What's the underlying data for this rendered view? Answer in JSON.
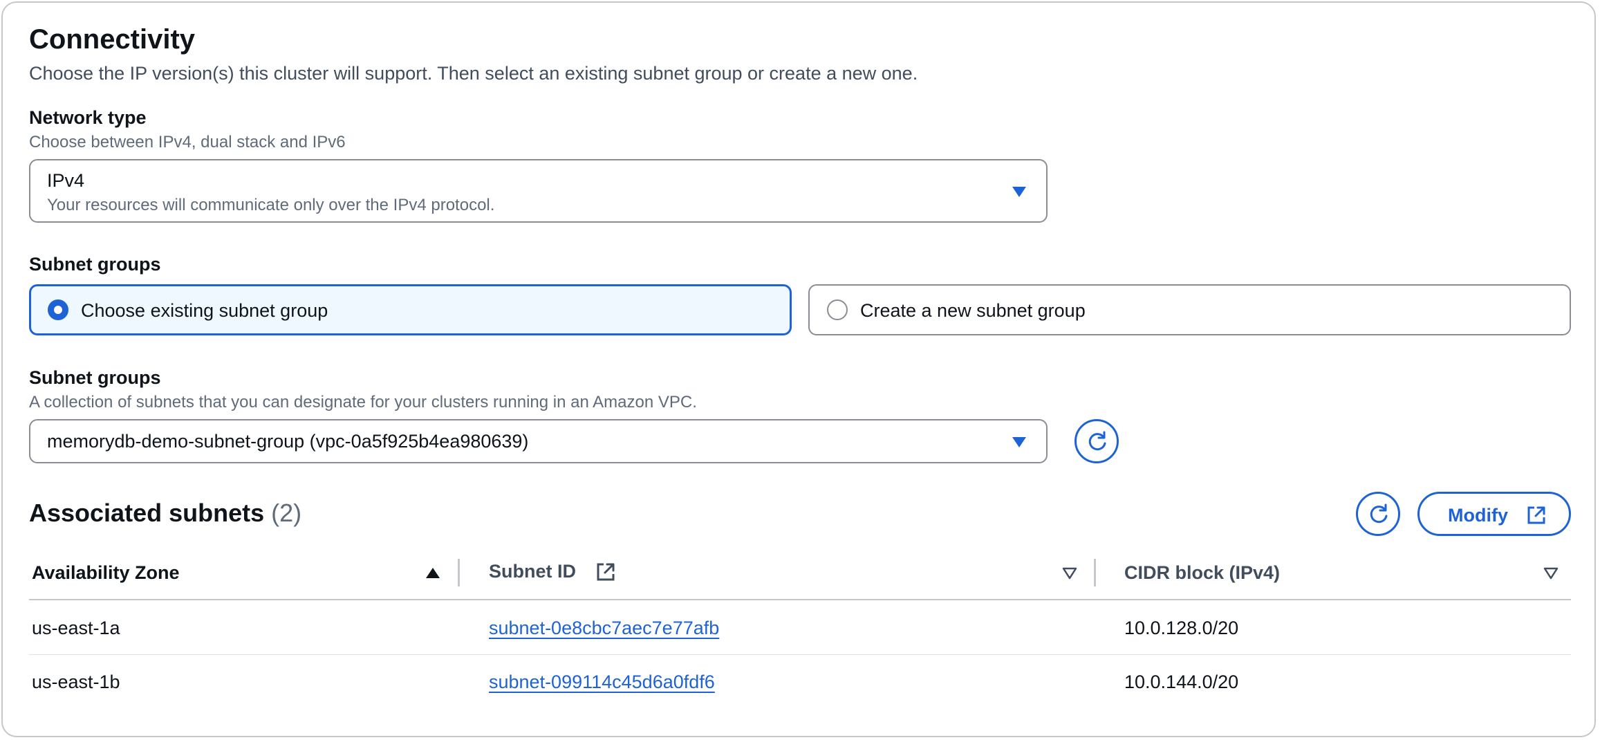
{
  "connectivity": {
    "title": "Connectivity",
    "description": "Choose the IP version(s) this cluster will support. Then select an existing subnet group or create a new one."
  },
  "network_type": {
    "label": "Network type",
    "description": "Choose between IPv4, dual stack and IPv6",
    "selected_value": "IPv4",
    "selected_hint": "Your resources will communicate only over the IPv4 protocol."
  },
  "subnet_group_mode": {
    "label": "Subnet groups",
    "options": [
      {
        "label": "Choose existing subnet group",
        "selected": true
      },
      {
        "label": "Create a new subnet group",
        "selected": false
      }
    ]
  },
  "subnet_groups": {
    "label": "Subnet groups",
    "description": "A collection of subnets that you can designate for your clusters running in an Amazon VPC.",
    "selected_value": "memorydb-demo-subnet-group (vpc-0a5f925b4ea980639)"
  },
  "associated_subnets": {
    "title": "Associated subnets",
    "count": "(2)",
    "modify_label": "Modify",
    "columns": [
      "Availability Zone",
      "Subnet ID",
      "CIDR block (IPv4)"
    ],
    "rows": [
      {
        "az": "us-east-1a",
        "subnet_id": "subnet-0e8cbc7aec7e77afb",
        "cidr": "10.0.128.0/20"
      },
      {
        "az": "us-east-1b",
        "subnet_id": "subnet-099114c45d6a0fdf6",
        "cidr": "10.0.144.0/20"
      }
    ]
  },
  "colors": {
    "accent": "#1e63d6",
    "selected_tile_bg": "#f0f8ff",
    "border": "#8c8c94"
  },
  "icons": [
    "caret-down-icon",
    "refresh-icon",
    "external-link-icon",
    "sort-ascending-icon",
    "sort-descending-icon"
  ]
}
